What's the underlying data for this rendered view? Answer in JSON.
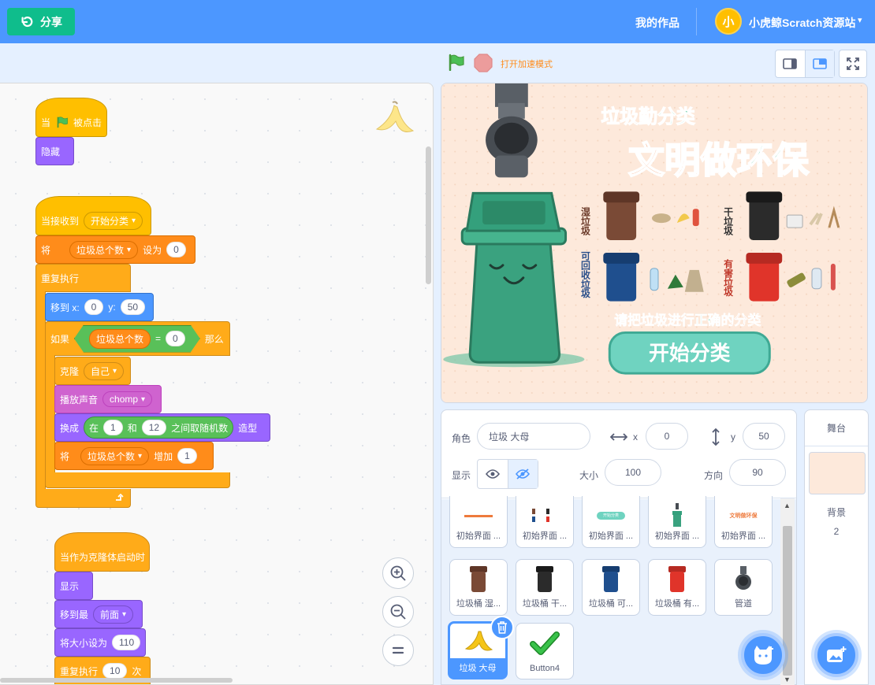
{
  "topbar": {
    "share_label": "分享",
    "my_works": "我的作品",
    "avatar_text": "小",
    "user_name": "小虎鲸Scratch资源站",
    "caret": "▾"
  },
  "stage_controls": {
    "turbo_label": "打开加速模式"
  },
  "scripts": {
    "s1": {
      "when": "当",
      "clicked": "被点击",
      "hide": "隐藏"
    },
    "s2": {
      "when_receive": "当接收到",
      "message": "开始分类",
      "set": "将",
      "var": "垃圾总个数",
      "set_to": "设为",
      "set_value": "0",
      "forever": "重复执行",
      "goto_x": "移到 x:",
      "x_value": "0",
      "goto_y": "y:",
      "y_value": "50",
      "if": "如果",
      "eq_var": "垃圾总个数",
      "eq_sign": "=",
      "eq_value": "0",
      "then": "那么",
      "clone": "克隆",
      "clone_target": "自己",
      "play_sound": "播放声音",
      "sound": "chomp",
      "switch": "换成",
      "in": "在",
      "rand_from": "1",
      "and": "和",
      "rand_to": "12",
      "pick": "之间取随机数",
      "costume": "造型",
      "change": "将",
      "change_var": "垃圾总个数",
      "increase": "增加",
      "change_value": "1"
    },
    "s3": {
      "when_clone": "当作为克隆体启动时",
      "show": "显示",
      "goto_front": "移到最",
      "front": "前面",
      "set_size": "将大小设为",
      "size_value": "110",
      "repeat": "重复执行",
      "repeat_value": "10",
      "times": "次"
    }
  },
  "sprite_info": {
    "sprite_label": "角色",
    "sprite_name": "垃圾 大母",
    "x_label": "x",
    "x_value": "0",
    "y_label": "y",
    "y_value": "50",
    "show_label": "显示",
    "size_label": "大小",
    "size_value": "100",
    "direction_label": "方向",
    "direction_value": "90"
  },
  "sprites": {
    "row1": [
      "初始界面 ...",
      "初始界面 ...",
      "初始界面 ...",
      "初始界面 ...",
      "初始界面 ..."
    ],
    "row2": [
      "垃圾桶 湿...",
      "垃圾桶 干...",
      "垃圾桶 可...",
      "垃圾桶 有...",
      "管道"
    ],
    "selected": "垃圾 大母",
    "button4": "Button4",
    "mini_start": "开始分类",
    "mini_title": "文明做环保"
  },
  "stage_pane": {
    "title": "舞台",
    "backdrop_label": "背景",
    "backdrop_count": "2"
  },
  "stage": {
    "title1_a": "垃圾勤",
    "title1_b": "分类",
    "title2_a": "文明做",
    "title2_b": "环保",
    "wet": "湿垃圾",
    "dry": "干垃圾",
    "recyclable": "可回收垃圾",
    "hazardous": "有害垃圾",
    "hint_a": "请把垃圾进行",
    "hint_b": "正确",
    "hint_c": "的分类",
    "start_button": "开始分类"
  },
  "colors": {
    "topbar": "#4c97ff",
    "share": "#0fbd8c",
    "events": "#ffbf00",
    "control": "#ffab19",
    "looks": "#9966ff",
    "motion": "#4c97ff",
    "variables": "#ff8c1a",
    "sound": "#cf63cf",
    "operators": "#59c059",
    "stage_bg": "#fde9db",
    "bin_green": "#3aa27f"
  }
}
